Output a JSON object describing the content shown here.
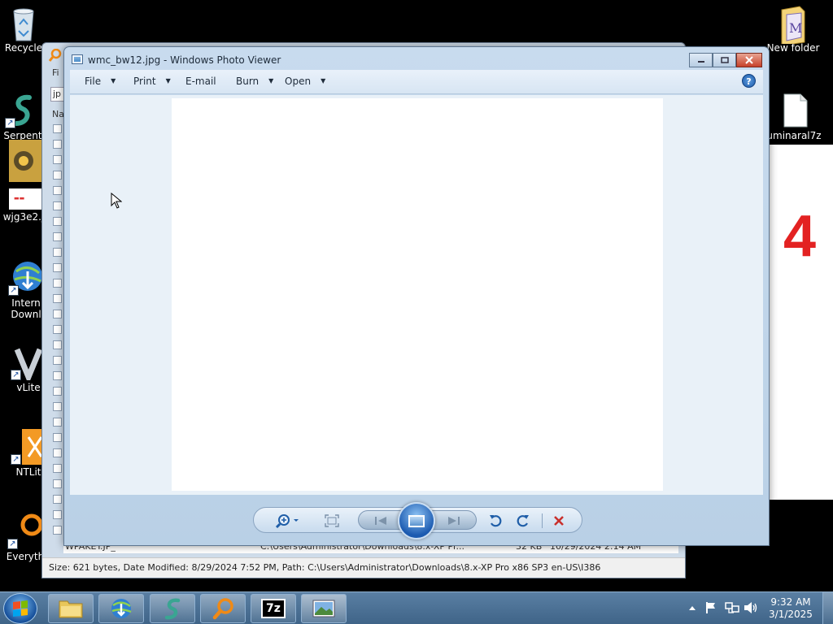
{
  "desktop": {
    "icons": [
      {
        "label": "Recycle",
        "icon": "recycle-bin-icon"
      },
      {
        "label": "New folder",
        "icon": "folder-icon"
      },
      {
        "label": "Serpent",
        "icon": "serpent-icon"
      },
      {
        "label": "uminaral7z",
        "icon": "file-icon"
      },
      {
        "label": "wjg3e2.j",
        "icon": "image-file-icon"
      },
      {
        "label": "Intern",
        "label2": "Downl",
        "icon": "internet-download-manager-icon"
      },
      {
        "label": "vLite",
        "icon": "vlite-icon"
      },
      {
        "label": "NTLit",
        "icon": "ntlite-icon"
      },
      {
        "label": "Everyth",
        "icon": "everything-search-icon"
      }
    ],
    "wallpaper_number": "4"
  },
  "explorer_window": {
    "left_labels": [
      "Fi",
      "jp",
      "Na"
    ],
    "last_row": {
      "name": "WPAKEY.JP_",
      "path": "C:\\Users\\Administrator\\Downloads\\8.x-XP Pr...",
      "size": "32 KB",
      "date": "10/29/2024 2:14 AM"
    },
    "status": "Size: 621 bytes, Date Modified: 8/29/2024 7:52 PM, Path: C:\\Users\\Administrator\\Downloads\\8.x-XP Pro x86 SP3 en-US\\I386"
  },
  "photo_viewer": {
    "title": "wmc_bw12.jpg - Windows Photo Viewer",
    "menu": {
      "file": "File",
      "print": "Print",
      "email": "E-mail",
      "burn": "Burn",
      "open": "Open"
    },
    "help": "?",
    "controls": {
      "zoom": "zoom-icon",
      "actual_size": "actual-size-icon",
      "previous": "previous-icon",
      "slideshow": "slideshow-icon",
      "next": "next-icon",
      "rotate_ccw": "rotate-counterclockwise-icon",
      "rotate_cw": "rotate-clockwise-icon",
      "delete": "delete-icon"
    }
  },
  "taskbar": {
    "apps": [
      "file-explorer-icon",
      "internet-download-manager-icon",
      "serpent-icon",
      "everything-search-icon",
      "7zip-icon",
      "photo-viewer-icon"
    ],
    "seven_zip_label": "7z",
    "clock": {
      "time": "9:32 AM",
      "date": "3/1/2025"
    }
  },
  "colors": {
    "accent": "#3f6488",
    "close": "#c7412a",
    "wallpaper_digit": "#e32222"
  }
}
